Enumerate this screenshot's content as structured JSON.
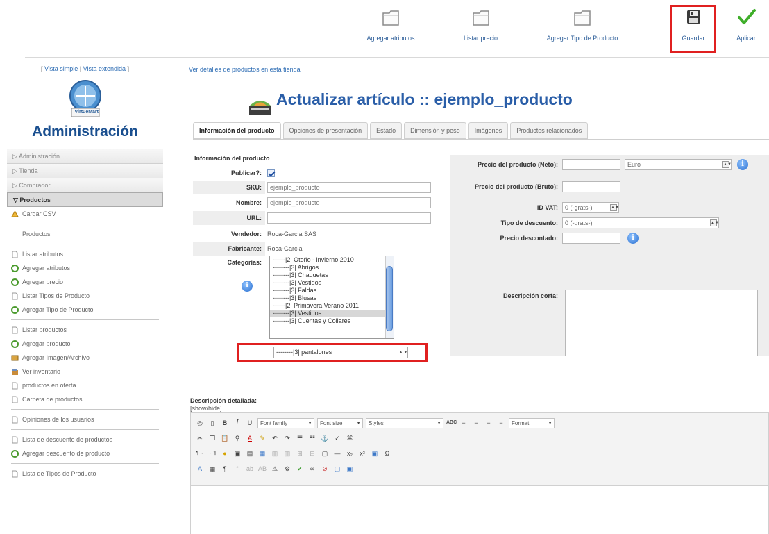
{
  "toolbar": {
    "buttons": [
      {
        "label": "Agregar atributos",
        "icon": "folder-icon"
      },
      {
        "label": "Listar precio",
        "icon": "folder-icon"
      },
      {
        "label": "Agregar Tipo de Producto",
        "icon": "folder-icon"
      },
      {
        "label": "Guardar",
        "icon": "floppy-icon"
      },
      {
        "label": "Aplicar",
        "icon": "checkmark-icon"
      }
    ]
  },
  "sidebar": {
    "view_simple": "Vista simple",
    "view_extended": "Vista extendida",
    "logo_text": "VirtueMart",
    "title": "Administración",
    "sections": [
      "Administración",
      "Tienda",
      "Comprador",
      "Productos"
    ],
    "items": [
      {
        "label": "Cargar CSV",
        "icon": "upload-icon"
      },
      {
        "label": "Productos",
        "icon": ""
      },
      {
        "label": "Listar atributos",
        "icon": "list-icon"
      },
      {
        "label": "Agregar atributos",
        "icon": "add-icon"
      },
      {
        "label": "Agregar precio",
        "icon": "add-icon"
      },
      {
        "label": "Listar Tipos de Producto",
        "icon": "list-icon"
      },
      {
        "label": "Agregar Tipo de Producto",
        "icon": "add-icon"
      },
      {
        "label": "Listar productos",
        "icon": "list-icon"
      },
      {
        "label": "Agregar producto",
        "icon": "add-icon"
      },
      {
        "label": "Agregar Imagen/Archivo",
        "icon": "image-icon"
      },
      {
        "label": "Ver inventario",
        "icon": "inventory-icon"
      },
      {
        "label": "productos en oferta",
        "icon": "list-icon"
      },
      {
        "label": "Carpeta de productos",
        "icon": "list-icon"
      },
      {
        "label": "Opiniones de los usuarios",
        "icon": "list-icon"
      },
      {
        "label": "Lista de descuento de productos",
        "icon": "list-icon"
      },
      {
        "label": "Agregar descuento de producto",
        "icon": "add-icon"
      },
      {
        "label": "Lista de Tipos de Producto",
        "icon": "list-icon"
      }
    ]
  },
  "main": {
    "details_link": "Ver detalles de productos en esta tienda",
    "title": "Actualizar artículo :: ejemplo_producto",
    "tabs": [
      "Información del producto",
      "Opciones de presentación",
      "Estado",
      "Dimensión y peso",
      "Imágenes",
      "Productos relacionados"
    ],
    "section_title": "Información del producto",
    "fields": {
      "publish_label": "Publicar?:",
      "sku_label": "SKU:",
      "sku_value": "ejemplo_producto",
      "name_label": "Nombre:",
      "name_value": "ejemplo_producto",
      "url_label": "URL:",
      "url_value": "",
      "vendor_label": "Vendedor:",
      "vendor_value": "Roca-Garcia SAS",
      "manufacturer_label": "Fabricante:",
      "manufacturer_value": "Roca-Garcia",
      "categories_label": "Categorías:"
    },
    "categories": [
      {
        "label": "------|2| Otoño - invierno 2010",
        "selected": false
      },
      {
        "label": "--------|3| Abrigos",
        "selected": false
      },
      {
        "label": "--------|3| Chaquetas",
        "selected": false
      },
      {
        "label": "--------|3| Vestidos",
        "selected": false
      },
      {
        "label": "--------|3| Faldas",
        "selected": false
      },
      {
        "label": "--------|3| Blusas",
        "selected": false
      },
      {
        "label": "------|2| Primavera Verano 2011",
        "selected": false
      },
      {
        "label": "--------|3| Vestidos",
        "selected": true
      },
      {
        "label": "--------|3| Cuentas y Collares",
        "selected": false
      }
    ],
    "category_select_value": "--------|3| pantalones",
    "price": {
      "net_label": "Precio del producto (Neto):",
      "net_value": "",
      "currency": "Euro",
      "gross_label": "Precio del producto (Bruto):",
      "gross_value": "",
      "vat_label": "ID VAT:",
      "vat_value": "0 (-grats-)",
      "discount_type_label": "Tipo de descuento:",
      "discount_type_value": "0 (-grats-)",
      "discounted_label": "Precio descontado:",
      "discounted_value": "",
      "short_desc_label": "Descripción corta:"
    },
    "description": {
      "title": "Descripción detallada:",
      "showhide": "[show/hide]"
    },
    "editor": {
      "font_family": "Font family",
      "font_size": "Font size",
      "styles": "Styles",
      "format": "Format"
    }
  },
  "colors": {
    "accent": "#2a5ea8",
    "highlight": "#e02020"
  }
}
